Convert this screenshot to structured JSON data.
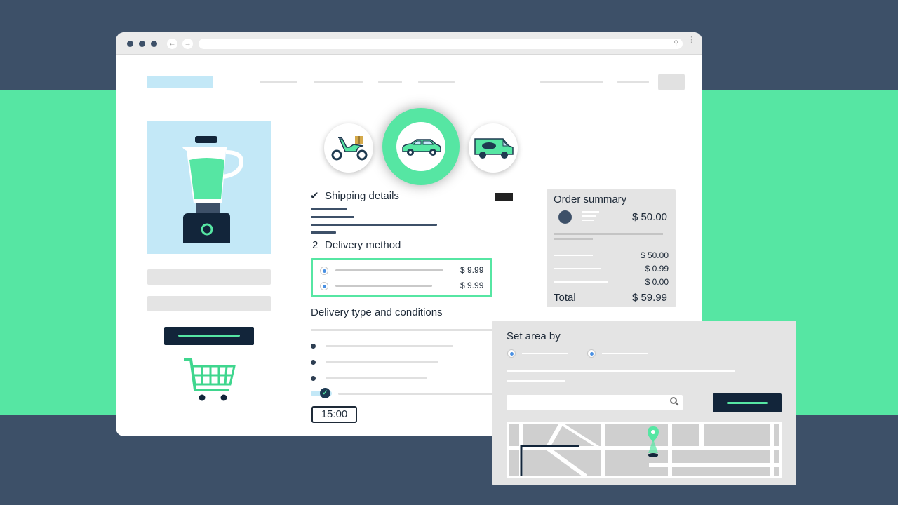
{
  "browser": {
    "back_glyph": "←",
    "forward_glyph": "→",
    "menu_glyph": "⋮",
    "url_search_glyph": "⚲"
  },
  "shipping": {
    "label": "Shipping details",
    "check_glyph": "✔"
  },
  "delivery": {
    "step_number": "2",
    "label": "Delivery method",
    "options": [
      {
        "price": "$ 9.99"
      },
      {
        "price": "$ 9.99"
      }
    ],
    "type_heading": "Delivery type and conditions",
    "toggle_glyph": "✓",
    "time": "15:00"
  },
  "vehicles": [
    "scooter-icon",
    "car-icon",
    "van-icon"
  ],
  "selected_vehicle": "car-icon",
  "order_summary": {
    "title": "Order summary",
    "item_price": "$ 50.00",
    "lines": [
      "$ 50.00",
      "$ 0.99",
      "$ 0.00"
    ],
    "total_label": "Total",
    "total_value": "$ 59.99"
  },
  "area_panel": {
    "title": "Set area by"
  },
  "colors": {
    "background": "#3d5068",
    "accent": "#56e6a3",
    "dark": "#12253a",
    "light_blue": "#c3e8f7"
  }
}
